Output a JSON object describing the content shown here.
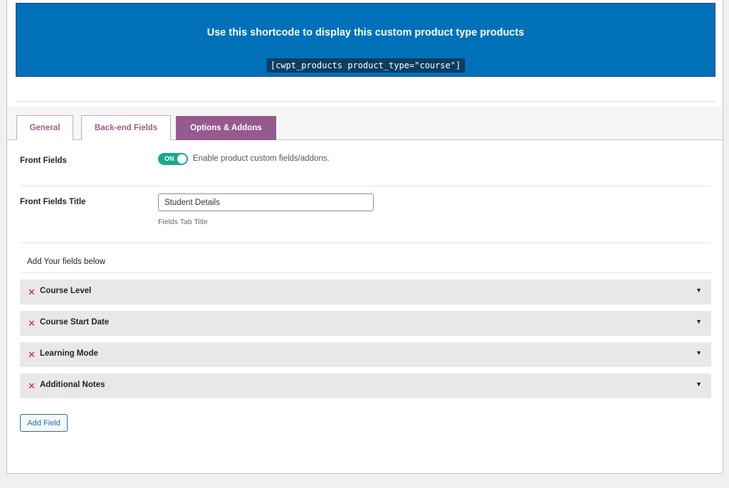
{
  "shortcode": {
    "title": "Use this shortcode to display this custom product type products",
    "code": "[cwpt_products product_type=\"course\"]"
  },
  "tabs": [
    {
      "label": "General",
      "active": false
    },
    {
      "label": "Back-end Fields",
      "active": false
    },
    {
      "label": "Options & Addons",
      "active": true
    }
  ],
  "front_fields": {
    "label": "Front Fields",
    "toggle_label": "ON",
    "toggle_state": true,
    "description": "Enable product custom fields/addons."
  },
  "front_fields_title": {
    "label": "Front Fields Title",
    "value": "Student Details",
    "hint": "Fields Tab Title"
  },
  "fields_section": {
    "heading": "Add Your fields below",
    "remove_glyph": "✕",
    "expand_glyph": "▼",
    "items": [
      {
        "name": "Course Level"
      },
      {
        "name": "Course Start Date"
      },
      {
        "name": "Learning Mode"
      },
      {
        "name": "Additional Notes"
      }
    ]
  },
  "add_field_label": "Add Field",
  "colors": {
    "banner": "#0071b9",
    "tab_active": "#965a8f",
    "toggle_on": "#1aa98e",
    "remove": "#c0262d"
  }
}
